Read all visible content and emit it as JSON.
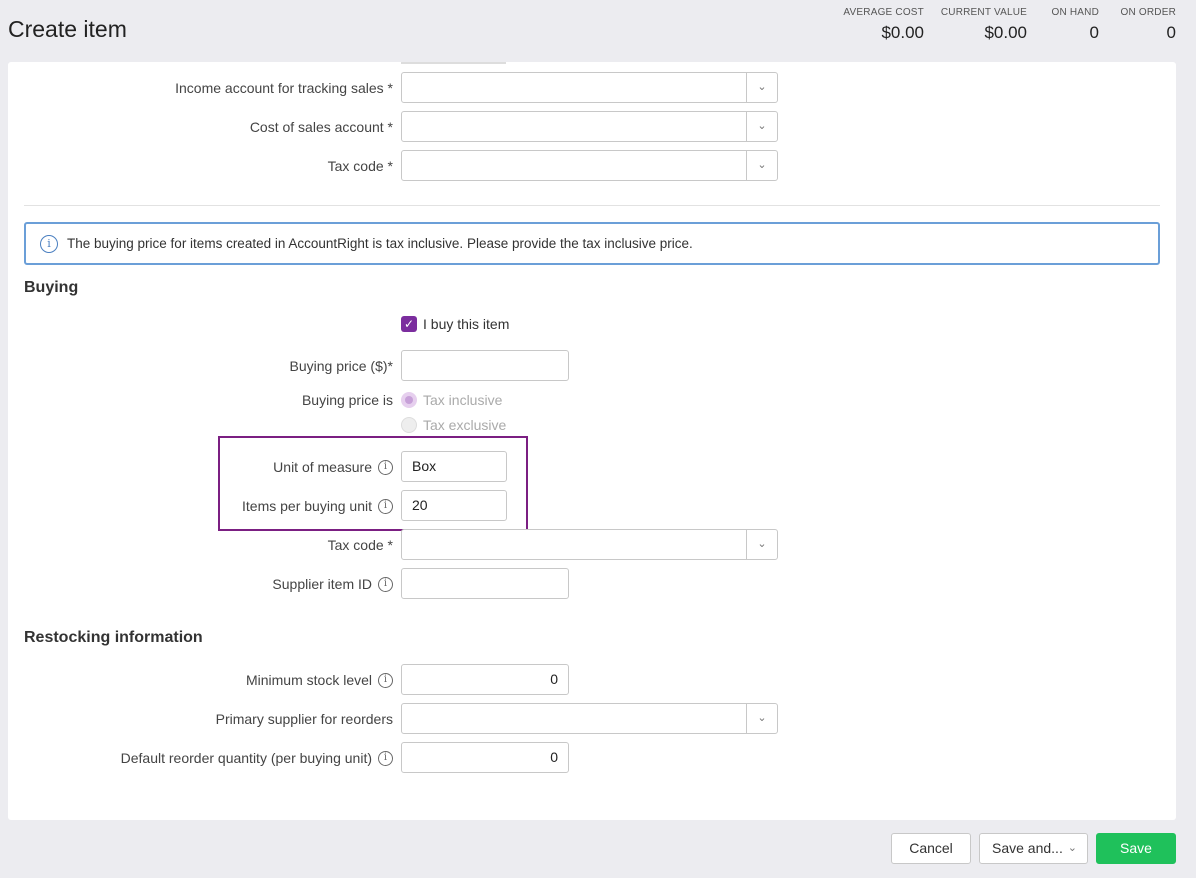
{
  "header": {
    "title": "Create item",
    "stats": [
      {
        "label": "AVERAGE COST",
        "value": "$0.00"
      },
      {
        "label": "CURRENT VALUE",
        "value": "$0.00"
      },
      {
        "label": "ON HAND",
        "value": "0"
      },
      {
        "label": "ON ORDER",
        "value": "0"
      }
    ]
  },
  "selling": {
    "income_account": "Income account for tracking sales *",
    "cost_of_sales": "Cost of sales account *",
    "tax_code": "Tax code *"
  },
  "notice": "The buying price for items created in AccountRight is tax inclusive. Please provide the tax inclusive price.",
  "buying": {
    "heading": "Buying",
    "buy_checkbox": "I buy this item",
    "buying_price_label": "Buying price ($)*",
    "buying_price_is": "Buying price is",
    "tax_inclusive": "Tax inclusive",
    "tax_exclusive": "Tax exclusive",
    "unit_label": "Unit of measure",
    "unit_value": "Box",
    "items_per_label": "Items per buying unit",
    "items_per_value": "20",
    "tax_code": "Tax code *",
    "supplier_id": "Supplier item ID"
  },
  "restocking": {
    "heading": "Restocking information",
    "min_label": "Minimum stock level",
    "min_value": "0",
    "primary_label": "Primary supplier for reorders",
    "reorder_label": "Default reorder quantity (per buying unit)",
    "reorder_value": "0"
  },
  "footer": {
    "cancel": "Cancel",
    "save_and": "Save and...",
    "save": "Save"
  },
  "colors": {
    "accent": "#7b2d9e",
    "save": "#1fc15b",
    "notice_border": "#6b9fd8"
  }
}
